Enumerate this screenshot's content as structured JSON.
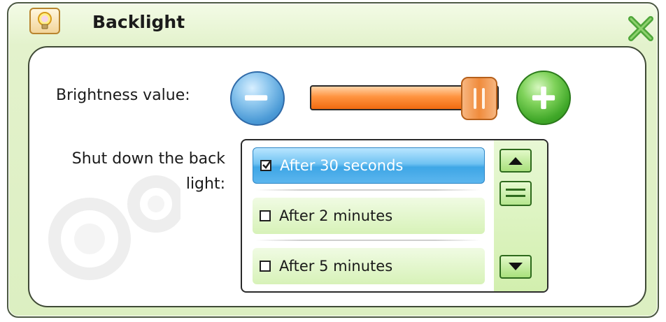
{
  "window": {
    "title": "Backlight",
    "title_icon": "lightbulb-icon",
    "close_icon": "close-icon"
  },
  "brightness": {
    "label": "Brightness value:",
    "decrease_icon": "minus-icon",
    "increase_icon": "plus-icon",
    "level_fraction": 0.82
  },
  "shutdown": {
    "label": "Shut down the back light:",
    "options": [
      {
        "label": "After 30 seconds",
        "checked": true
      },
      {
        "label": "After 2 minutes",
        "checked": false
      },
      {
        "label": "After 5 minutes",
        "checked": false
      }
    ],
    "scroll_up_icon": "arrow-up-icon",
    "scroll_down_icon": "arrow-down-icon"
  },
  "colors": {
    "accent_green": "#3fa728",
    "accent_blue": "#4b9ad6",
    "slider_orange": "#f06a10",
    "window_bg": "#dcefc1"
  }
}
